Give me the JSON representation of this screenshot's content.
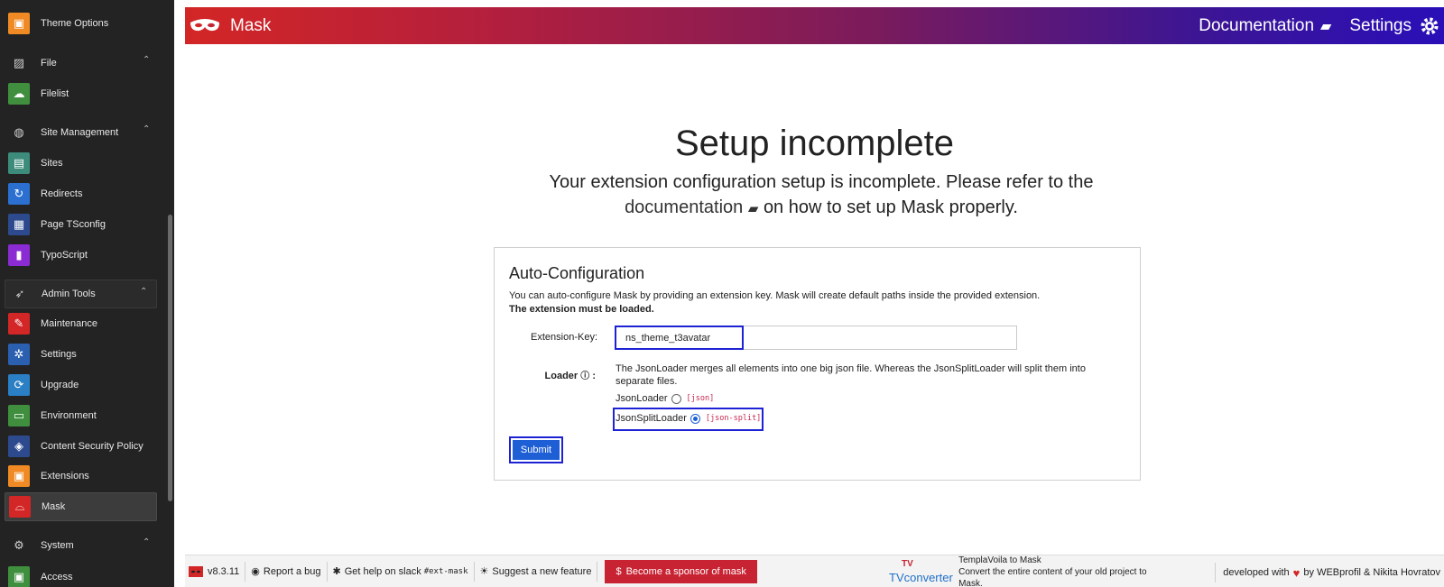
{
  "sidebar": {
    "items": [
      {
        "label": "Theme Options",
        "icon": "box-icon",
        "color": "#f08a24",
        "glyph": "▣",
        "type": "item"
      },
      {
        "label": "File",
        "icon": "image-icon",
        "type": "group",
        "glyph": "▨"
      },
      {
        "label": "Filelist",
        "icon": "cloud-icon",
        "color": "#3f8f3f",
        "glyph": "☁",
        "type": "item"
      },
      {
        "label": "Site Management",
        "icon": "globe-icon",
        "type": "group",
        "glyph": "◍"
      },
      {
        "label": "Sites",
        "icon": "sites-icon",
        "color": "#3d8b7a",
        "glyph": "▤",
        "type": "item"
      },
      {
        "label": "Redirects",
        "icon": "redirect-icon",
        "color": "#2b6fd1",
        "glyph": "↻",
        "type": "item"
      },
      {
        "label": "Page TSconfig",
        "icon": "tsconfig-icon",
        "color": "#2e4a8e",
        "glyph": "▦",
        "type": "item"
      },
      {
        "label": "TypoScript",
        "icon": "typoscript-icon",
        "color": "#8a2bd3",
        "glyph": "▮",
        "type": "item"
      },
      {
        "label": "Admin Tools",
        "icon": "rocket-icon",
        "type": "group-box",
        "glyph": "➶"
      },
      {
        "label": "Maintenance",
        "icon": "wrench-icon",
        "color": "#d32626",
        "glyph": "✎",
        "type": "item"
      },
      {
        "label": "Settings",
        "icon": "gear-icon",
        "color": "#2b5fb0",
        "glyph": "✲",
        "type": "item"
      },
      {
        "label": "Upgrade",
        "icon": "upgrade-icon",
        "color": "#2b7fc4",
        "glyph": "⟳",
        "type": "item"
      },
      {
        "label": "Environment",
        "icon": "environment-icon",
        "color": "#3f8f3f",
        "glyph": "▭",
        "type": "item"
      },
      {
        "label": "Content Security Policy",
        "icon": "shield-icon",
        "color": "#2e4a8e",
        "glyph": "◈",
        "type": "item"
      },
      {
        "label": "Extensions",
        "icon": "extensions-icon",
        "color": "#f08a24",
        "glyph": "▣",
        "type": "item"
      },
      {
        "label": "Mask",
        "icon": "mask-icon",
        "color": "#d32626",
        "glyph": "⌓",
        "type": "active"
      },
      {
        "label": "System",
        "icon": "system-gear-icon",
        "type": "group",
        "glyph": "⚙"
      },
      {
        "label": "Access",
        "icon": "access-icon",
        "color": "#3f8f3f",
        "glyph": "▣",
        "type": "item"
      }
    ]
  },
  "header": {
    "brand": "Mask",
    "documentation_label": "Documentation",
    "settings_label": "Settings"
  },
  "main": {
    "title": "Setup incomplete",
    "subtitle_part1": "Your extension configuration setup is incomplete. Please refer to the",
    "subtitle_link": "documentation",
    "subtitle_part2": "on how to set up Mask properly.",
    "panel": {
      "heading": "Auto-Configuration",
      "desc": "You can auto-configure Mask by providing an extension key. Mask will create default paths inside the provided extension.",
      "desc_bold": "The extension must be loaded.",
      "ext_key_label": "Extension-Key:",
      "ext_key_value": "ns_theme_t3avatar",
      "loader_label": "Loader",
      "loader_desc": "The JsonLoader merges all elements into one big json file. Whereas the JsonSplitLoader will split them into separate files.",
      "option1_label": "JsonLoader",
      "option1_code": "[json]",
      "option2_label": "JsonSplitLoader",
      "option2_code": "[json-split]",
      "submit_label": "Submit"
    }
  },
  "footer": {
    "version": "v8.3.11",
    "report_bug": "Report a bug",
    "slack_help": "Get help on slack",
    "slack_channel": "#ext-mask",
    "suggest": "Suggest a new feature",
    "sponsor": "Become a sponsor of mask",
    "tv_brand_top": "TV",
    "tv_brand": "TVconverter",
    "tv_title": "TemplaVoila to Mask",
    "tv_desc": "Convert the entire content of your old project to Mask.",
    "dev_prefix": "developed with",
    "dev_suffix": "by WEBprofil & Nikita Hovratov"
  },
  "colors": {
    "accent_blue": "#1f5fd6",
    "highlight_border": "#1d22d4",
    "sponsor_red": "#c82333",
    "header_start": "#d32626",
    "header_end": "#2a0fb8"
  }
}
